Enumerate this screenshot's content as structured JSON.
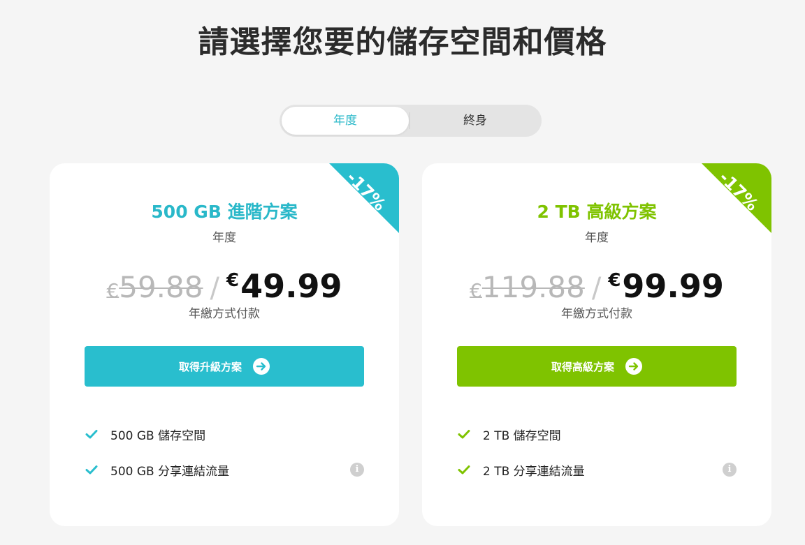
{
  "page": {
    "title": "請選擇您要的儲存空間和價格"
  },
  "billing_toggle": {
    "options": [
      {
        "label": "年度",
        "selected": true
      },
      {
        "label": "終身",
        "selected": false
      }
    ]
  },
  "plans": [
    {
      "badge": "-17%",
      "name": "500 GB 進階方案",
      "period": "年度",
      "currency": "€",
      "old_price": "59.88",
      "new_price": "49.99",
      "billing_note": "年繳方式付款",
      "cta_label": "取得升級方案",
      "accent_color": "#29bece",
      "features": [
        {
          "text": "500 GB 儲存空間",
          "has_info": false
        },
        {
          "text": "500 GB 分享連結流量",
          "has_info": true
        }
      ]
    },
    {
      "badge": "-17%",
      "name": "2 TB 高級方案",
      "period": "年度",
      "currency": "€",
      "old_price": "119.88",
      "new_price": "99.99",
      "billing_note": "年繳方式付款",
      "cta_label": "取得高級方案",
      "accent_color": "#7fc300",
      "features": [
        {
          "text": "2 TB 儲存空間",
          "has_info": false
        },
        {
          "text": "2 TB 分享連結流量",
          "has_info": true
        }
      ]
    }
  ],
  "icons": {
    "check": "check-icon",
    "info": "info-icon",
    "arrow": "arrow-right-icon"
  },
  "colors": {
    "background": "#f5f5f5",
    "teal": "#29bece",
    "green": "#7fc300"
  }
}
